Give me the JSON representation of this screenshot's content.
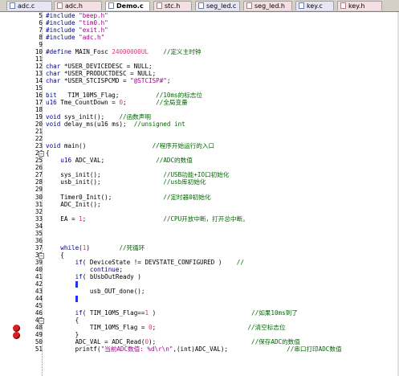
{
  "tabs": [
    {
      "label": "adc.c",
      "kind": "c"
    },
    {
      "label": "adc.h",
      "kind": "h"
    },
    {
      "label": "Demo.c",
      "kind": "active"
    },
    {
      "label": "stc.h",
      "kind": "h"
    },
    {
      "label": "seg_led.c",
      "kind": "c"
    },
    {
      "label": "seg_led.h",
      "kind": "h"
    },
    {
      "label": "key.c",
      "kind": "c"
    },
    {
      "label": "key.h",
      "kind": "h"
    }
  ],
  "lines": [
    {
      "n": "5",
      "segs": [
        [
          "kw",
          "#include "
        ],
        [
          "str",
          "\"beep.h\""
        ]
      ]
    },
    {
      "n": "6",
      "segs": [
        [
          "kw",
          "#include "
        ],
        [
          "str",
          "\"tim0.h\""
        ]
      ]
    },
    {
      "n": "7",
      "segs": [
        [
          "kw",
          "#include "
        ],
        [
          "str",
          "\"exit.h\""
        ]
      ]
    },
    {
      "n": "8",
      "segs": [
        [
          "kw",
          "#include "
        ],
        [
          "str",
          "\"adc.h\""
        ]
      ]
    },
    {
      "n": "9",
      "segs": []
    },
    {
      "n": "10",
      "segs": [
        [
          "kw",
          "#define "
        ],
        [
          "t",
          "MAIN_Fosc "
        ],
        [
          "num",
          "24000000UL"
        ],
        [
          "t",
          "    "
        ],
        [
          "cmt",
          "//定义主时钟"
        ]
      ]
    },
    {
      "n": "11",
      "segs": []
    },
    {
      "n": "12",
      "segs": [
        [
          "kw",
          "char "
        ],
        [
          "t",
          "*USER_DEVICEDESC = NULL;"
        ]
      ]
    },
    {
      "n": "13",
      "segs": [
        [
          "kw",
          "char "
        ],
        [
          "t",
          "*USER_PRODUCTDESC = NULL;"
        ]
      ]
    },
    {
      "n": "14",
      "segs": [
        [
          "kw",
          "char "
        ],
        [
          "t",
          "*USER_STCISPCMD = "
        ],
        [
          "str",
          "\"@STCISP#\""
        ],
        [
          "t",
          ";"
        ]
      ]
    },
    {
      "n": "15",
      "segs": []
    },
    {
      "n": "16",
      "segs": [
        [
          "kw",
          "bit "
        ],
        [
          "t",
          "  TIM_10MS_Flag;          "
        ],
        [
          "cmt",
          "//10ms的标志位"
        ]
      ]
    },
    {
      "n": "17",
      "segs": [
        [
          "kw",
          "u16 "
        ],
        [
          "t",
          "Tme_CountDown = "
        ],
        [
          "num",
          "0"
        ],
        [
          "t",
          ";        "
        ],
        [
          "cmt",
          "//全局变量"
        ]
      ]
    },
    {
      "n": "18",
      "segs": []
    },
    {
      "n": "19",
      "segs": [
        [
          "kw",
          "void "
        ],
        [
          "t",
          "sys_init();    "
        ],
        [
          "cmt",
          "//函数声明"
        ]
      ]
    },
    {
      "n": "20",
      "segs": [
        [
          "kw",
          "void "
        ],
        [
          "t",
          "delay_ms(u16 ms);  "
        ],
        [
          "cmt",
          "//unsigned int"
        ]
      ]
    },
    {
      "n": "21",
      "segs": []
    },
    {
      "n": "22",
      "segs": []
    },
    {
      "n": "23",
      "segs": [
        [
          "kw",
          "void "
        ],
        [
          "t",
          "main()                  "
        ],
        [
          "cmt",
          "//程序开始运行的入口"
        ]
      ]
    },
    {
      "n": "24",
      "segs": [
        [
          "t",
          "{"
        ]
      ]
    },
    {
      "n": "25",
      "segs": [
        [
          "t",
          "    "
        ],
        [
          "kw",
          "u16 "
        ],
        [
          "t",
          "ADC_VAL;              "
        ],
        [
          "cmt",
          "//ADC的数值"
        ]
      ]
    },
    {
      "n": "26",
      "segs": []
    },
    {
      "n": "27",
      "segs": [
        [
          "t",
          "    sys_init();                 "
        ],
        [
          "cmt",
          "//USB功能+IO口初始化"
        ]
      ]
    },
    {
      "n": "28",
      "segs": [
        [
          "t",
          "    usb_init();                 "
        ],
        [
          "cmt",
          "//usb库初始化"
        ]
      ]
    },
    {
      "n": "29",
      "segs": []
    },
    {
      "n": "30",
      "segs": [
        [
          "t",
          "    Timer0_Init();              "
        ],
        [
          "cmt",
          "//定时器0初始化"
        ]
      ]
    },
    {
      "n": "31",
      "segs": [
        [
          "t",
          "    ADC_Init();"
        ]
      ]
    },
    {
      "n": "32",
      "segs": []
    },
    {
      "n": "33",
      "segs": [
        [
          "t",
          "    EA = "
        ],
        [
          "num",
          "1"
        ],
        [
          "t",
          ";                     "
        ],
        [
          "cmt",
          "//CPU开放中断，打开总中断。"
        ]
      ]
    },
    {
      "n": "34",
      "segs": []
    },
    {
      "n": "35",
      "segs": []
    },
    {
      "n": "36",
      "segs": []
    },
    {
      "n": "37",
      "segs": [
        [
          "t",
          "    "
        ],
        [
          "kw",
          "while"
        ],
        [
          "t",
          "("
        ],
        [
          "num",
          "1"
        ],
        [
          "t",
          ")        "
        ],
        [
          "cmt",
          "//死循环"
        ]
      ]
    },
    {
      "n": "38",
      "segs": [
        [
          "t",
          "    {"
        ]
      ]
    },
    {
      "n": "39",
      "segs": [
        [
          "t",
          "        "
        ],
        [
          "kw",
          "if"
        ],
        [
          "t",
          "( DeviceState != DEVSTATE_CONFIGURED )    "
        ],
        [
          "cmt",
          "//"
        ]
      ]
    },
    {
      "n": "40",
      "segs": [
        [
          "t",
          "            "
        ],
        [
          "kw",
          "continue"
        ],
        [
          "t",
          ";"
        ]
      ]
    },
    {
      "n": "41",
      "segs": [
        [
          "t",
          "        "
        ],
        [
          "kw",
          "if"
        ],
        [
          "t",
          "( bUsbOutReady )"
        ]
      ]
    },
    {
      "n": "42",
      "segs": [
        [
          "t",
          "        "
        ],
        [
          "cur",
          "{"
        ]
      ]
    },
    {
      "n": "43",
      "segs": [
        [
          "t",
          "            usb_OUT_done();"
        ]
      ]
    },
    {
      "n": "44",
      "segs": [
        [
          "t",
          "        "
        ],
        [
          "cur",
          "}"
        ]
      ]
    },
    {
      "n": "45",
      "segs": []
    },
    {
      "n": "46",
      "segs": [
        [
          "t",
          "        "
        ],
        [
          "kw",
          "if"
        ],
        [
          "t",
          "( TIM_10MS_Flag=="
        ],
        [
          "num",
          "1"
        ],
        [
          "t",
          " )                          "
        ],
        [
          "cmt",
          "//如果10ms到了"
        ]
      ]
    },
    {
      "n": "47",
      "segs": [
        [
          "t",
          "        {"
        ]
      ]
    },
    {
      "n": "48",
      "segs": [
        [
          "t",
          "            TIM_10MS_Flag = "
        ],
        [
          "num",
          "0"
        ],
        [
          "t",
          ";                         "
        ],
        [
          "cmt",
          "//清空标志位"
        ]
      ]
    },
    {
      "n": "49",
      "segs": [
        [
          "t",
          "        }"
        ]
      ]
    },
    {
      "n": "50",
      "segs": [
        [
          "t",
          "        ADC_VAL = ADC_Read("
        ],
        [
          "num",
          "0"
        ],
        [
          "t",
          ");                          "
        ],
        [
          "cmt",
          "//保存ADC的数值"
        ]
      ]
    },
    {
      "n": "51",
      "segs": [
        [
          "t",
          "        printf("
        ],
        [
          "str",
          "\"当前ADC数值: %d\\r\\n\""
        ],
        [
          "t",
          ",(int)ADC_VAL);                "
        ],
        [
          "cmt",
          "//串口打印ADC数值"
        ]
      ]
    }
  ],
  "breakpoint_lines": [
    "48",
    "49"
  ],
  "colors": {
    "keyword": "#00008b",
    "string": "#a0008a",
    "number": "#e03080",
    "comment": "#006400",
    "breakpoint": "#d42020"
  }
}
